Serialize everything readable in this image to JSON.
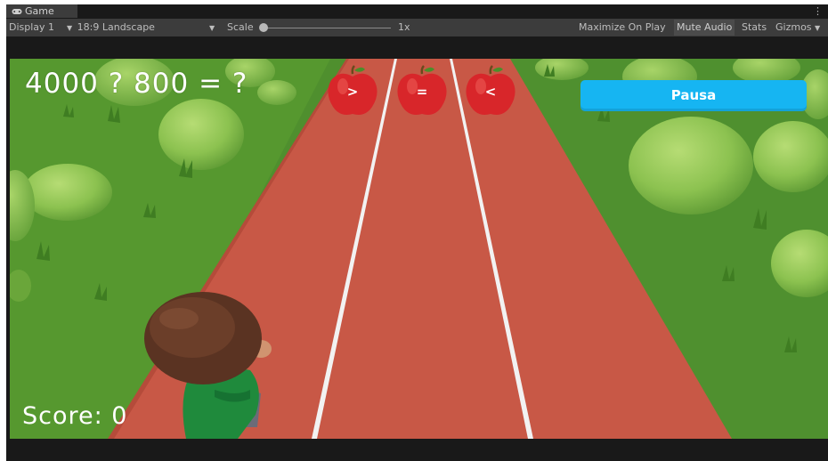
{
  "editor": {
    "tab_title": "Game",
    "toolbar": {
      "display": "Display 1",
      "aspect": "18:9 Landscape",
      "scale_label": "Scale",
      "scale_value": "1x",
      "maximize_on_play": "Maximize On Play",
      "mute_audio": "Mute Audio",
      "stats": "Stats",
      "gizmos": "Gizmos"
    }
  },
  "hud": {
    "equation": "4000 ? 800 = ?",
    "score": "Score: 0",
    "pause_label": "Pausa"
  },
  "apples": [
    {
      "label": ">"
    },
    {
      "label": "="
    },
    {
      "label": "<"
    }
  ],
  "colors": {
    "pause_button": "#16b5f2",
    "track": "#c85846",
    "grass": "#4a8a2c",
    "apple": "#d8262a"
  }
}
